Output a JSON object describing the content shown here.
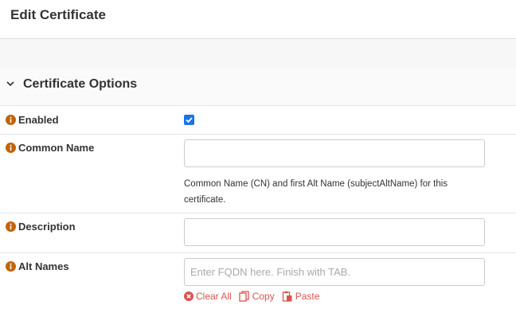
{
  "header": {
    "title": "Edit Certificate"
  },
  "section": {
    "title": "Certificate Options",
    "icon": "chevron-down-icon"
  },
  "fields": {
    "enabled": {
      "label": "Enabled",
      "checked": true
    },
    "common_name": {
      "label": "Common Name",
      "value": "",
      "help": "Common Name (CN) and first Alt Name (subjectAltName) for this certificate."
    },
    "description": {
      "label": "Description",
      "value": ""
    },
    "alt_names": {
      "label": "Alt Names",
      "value": "",
      "placeholder": "Enter FQDN here. Finish with TAB.",
      "actions": {
        "clear_all": "Clear All",
        "copy": "Copy",
        "paste": "Paste"
      }
    }
  },
  "colors": {
    "info_icon": "#c0640c",
    "action": "#d9534f",
    "checkbox": "#1a73e8"
  }
}
